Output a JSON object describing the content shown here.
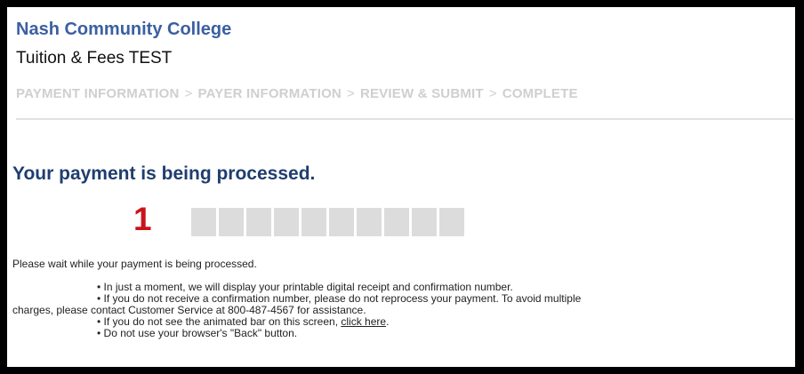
{
  "header": {
    "college_name": "Nash Community College",
    "page_title": "Tuition & Fees TEST"
  },
  "steps": {
    "items": [
      "PAYMENT INFORMATION",
      "PAYER INFORMATION",
      "REVIEW & SUBMIT",
      "COMPLETE"
    ],
    "separator": ">"
  },
  "main": {
    "status_heading": "Your payment is being processed.",
    "annotation_marker": "1",
    "progress_segments": 10,
    "wait_text": "Please wait while your payment is being processed.",
    "notes": {
      "line1": "• In just a moment, we will display your printable digital receipt and confirmation number.",
      "line2": "• If you do not receive a confirmation number, please do not reprocess your payment. To avoid multiple",
      "line3": "charges, please contact Customer Service at 800-487-4567 for assistance.",
      "line4_prefix": "• If you do not see the animated bar on this screen, ",
      "line4_link": "click here",
      "line4_suffix": ".",
      "line5": "• Do not use your browser's \"Back\" button."
    }
  },
  "colors": {
    "college_name": "#3b5fa3",
    "status_heading": "#1f3d6f",
    "marker": "#c8151b",
    "steps_inactive": "#cfcfcf",
    "progress_segment": "#dcdcdc"
  }
}
